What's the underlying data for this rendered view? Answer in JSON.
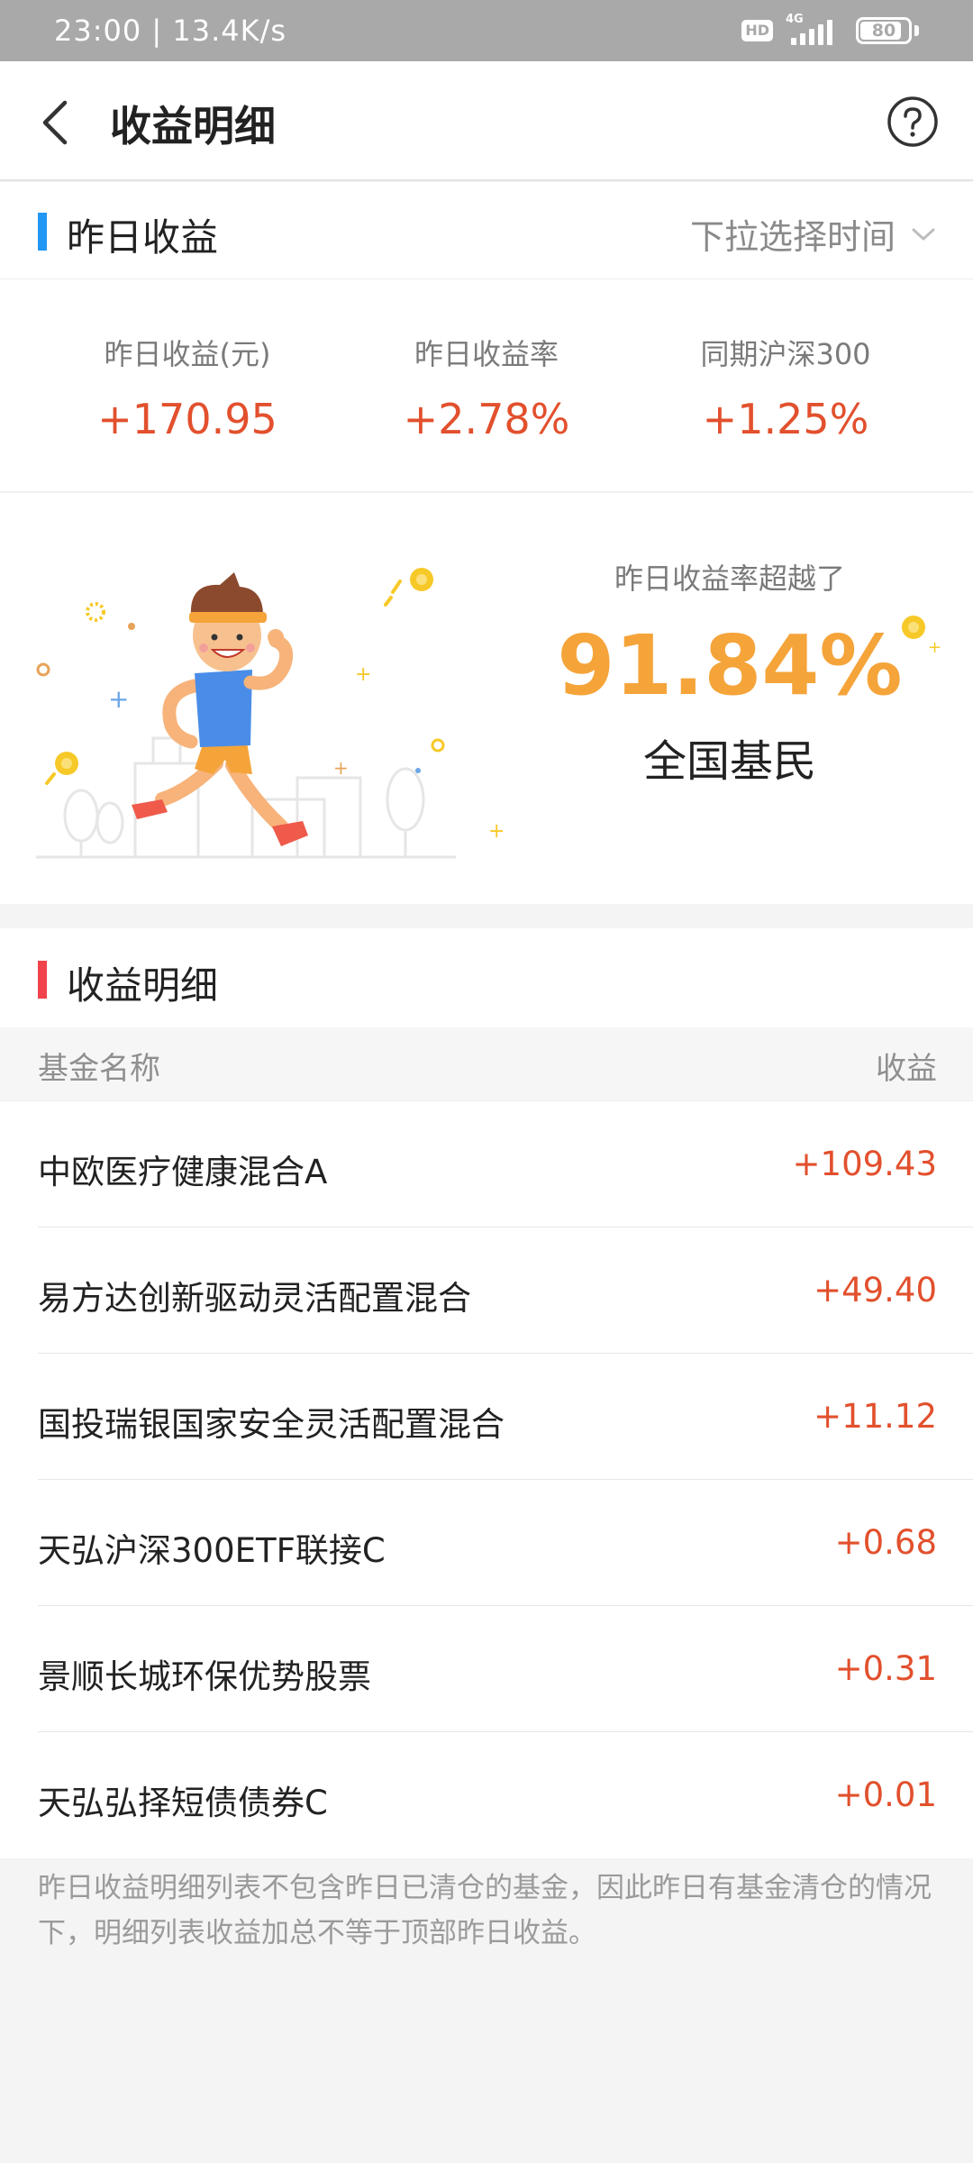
{
  "status_bar": {
    "time": "23:00 | 13.4K/s",
    "hd": "HD",
    "network": "4G",
    "battery": "80"
  },
  "header": {
    "title": "收益明细"
  },
  "yesterday": {
    "section_title": "昨日收益",
    "time_picker": "下拉选择时间",
    "accent_color": "#2196f3",
    "stats": [
      {
        "label": "昨日收益(元)",
        "value": "+170.95"
      },
      {
        "label": "昨日收益率",
        "value": "+2.78%"
      },
      {
        "label": "同期沪深300",
        "value": "+1.25%"
      }
    ],
    "beat": {
      "label": "昨日收益率超越了",
      "value": "91.84%",
      "sub": "全国基民"
    }
  },
  "detail": {
    "section_title": "收益明细",
    "accent_color": "#f0434b",
    "col_name": "基金名称",
    "col_income": "收益",
    "rows": [
      {
        "name": "中欧医疗健康混合A",
        "income": "+109.43"
      },
      {
        "name": "易方达创新驱动灵活配置混合",
        "income": "+49.40"
      },
      {
        "name": "国投瑞银国家安全灵活配置混合",
        "income": "+11.12"
      },
      {
        "name": "天弘沪深300ETF联接C",
        "income": "+0.68"
      },
      {
        "name": "景顺长城环保优势股票",
        "income": "+0.31"
      },
      {
        "name": "天弘弘择短债债券C",
        "income": "+0.01"
      }
    ],
    "footnote": "昨日收益明细列表不包含昨日已清仓的基金，因此昨日有基金清仓的情况下，明细列表收益加总不等于顶部昨日收益。"
  },
  "colors": {
    "positive": "#e2502d",
    "highlight": "#f5a43a"
  }
}
